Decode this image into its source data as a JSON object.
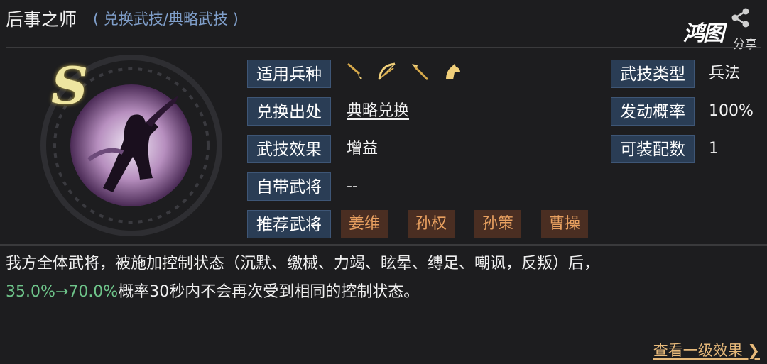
{
  "header": {
    "title": "后事之师",
    "subtitle": "( 兑换武技/典略武技 )",
    "share_label": "分享",
    "logo_text": "鸿图"
  },
  "skill": {
    "grade": "S"
  },
  "fields": {
    "troop_label": "适用兵种",
    "troop_icons": [
      "sword-icon",
      "bow-icon",
      "spear-icon",
      "horse-icon"
    ],
    "source_label": "兑换出处",
    "source_value": "典略兑换",
    "effect_label": "武技效果",
    "effect_value": "增益",
    "own_general_label": "自带武将",
    "own_general_value": "--",
    "recommend_label": "推荐武将",
    "recommend_generals": [
      "姜维",
      "孙权",
      "孙策",
      "曹操"
    ],
    "type_label": "武技类型",
    "type_value": "兵法",
    "rate_label": "发动概率",
    "rate_value": "100%",
    "equip_label": "可装配数",
    "equip_value": "1"
  },
  "description": {
    "line1": "我方全体武将，被施加控制状态（沉默、缴械、力竭、眩晕、缚足、嘲讽，反叛）后，",
    "pct": "35.0%→70.0%",
    "line2_rest": "概率30秒内不会再次受到相同的控制状态。"
  },
  "footer": {
    "more_label": "查看一级效果 ❯"
  },
  "colors": {
    "label_bg": "#2a3d55",
    "general_tag_bg": "#4a2e22",
    "general_tag_text": "#e8a060",
    "subtitle": "#7f9ec9",
    "percent_green": "#6ec48a",
    "link_orange": "#e6b97a"
  }
}
